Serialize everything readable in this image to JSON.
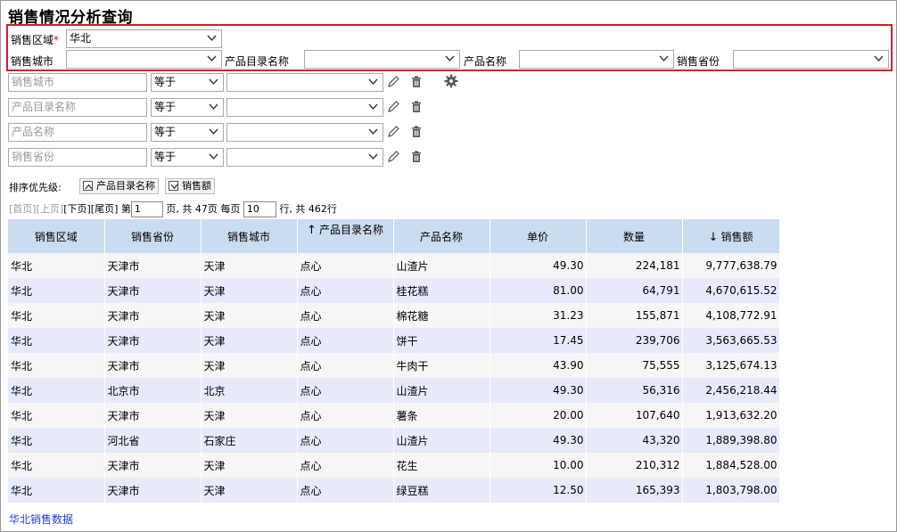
{
  "title": "销售情况分析查询",
  "params": {
    "region_label": "销售区域",
    "region_required": "*",
    "region_value": "华北",
    "city_label": "销售城市",
    "city_value": "",
    "catalog_label": "产品目录名称",
    "catalog_value": "",
    "product_label": "产品名称",
    "product_value": "",
    "province_label": "销售省份",
    "province_value": ""
  },
  "filters": [
    {
      "field_placeholder": "销售城市",
      "op": "等于",
      "value": ""
    },
    {
      "field_placeholder": "产品目录名称",
      "op": "等于",
      "value": ""
    },
    {
      "field_placeholder": "产品名称",
      "op": "等于",
      "value": ""
    },
    {
      "field_placeholder": "销售省份",
      "op": "等于",
      "value": ""
    }
  ],
  "sort": {
    "label": "排序优先级:",
    "items": [
      "产品目录名称",
      "销售额"
    ]
  },
  "pager": {
    "first": "[首页]",
    "prev": "[上页]",
    "next": "[下页]",
    "last": "[尾页]",
    "page_prefix": "第",
    "page_value": "1",
    "page_suffix": "页, 共 47页 每页",
    "per_page_value": "10",
    "total_suffix": "行, 共 462行"
  },
  "table": {
    "headers": [
      "销售区域",
      "销售省份",
      "销售城市",
      "产品目录名称",
      "产品名称",
      "单价",
      "数量",
      "销售额"
    ],
    "sort_up_arrow": "↑",
    "sort_down_arrow": "↓",
    "rows": [
      [
        "华北",
        "天津市",
        "天津",
        "点心",
        "山渣片",
        "49.30",
        "224,181",
        "9,777,638.79"
      ],
      [
        "华北",
        "天津市",
        "天津",
        "点心",
        "桂花糕",
        "81.00",
        "64,791",
        "4,670,615.52"
      ],
      [
        "华北",
        "天津市",
        "天津",
        "点心",
        "棉花糖",
        "31.23",
        "155,871",
        "4,108,772.91"
      ],
      [
        "华北",
        "天津市",
        "天津",
        "点心",
        "饼干",
        "17.45",
        "239,706",
        "3,563,665.53"
      ],
      [
        "华北",
        "天津市",
        "天津",
        "点心",
        "牛肉干",
        "43.90",
        "75,555",
        "3,125,674.13"
      ],
      [
        "华北",
        "北京市",
        "北京",
        "点心",
        "山渣片",
        "49.30",
        "56,316",
        "2,456,218.44"
      ],
      [
        "华北",
        "天津市",
        "天津",
        "点心",
        "薯条",
        "20.00",
        "107,640",
        "1,913,632.20"
      ],
      [
        "华北",
        "河北省",
        "石家庄",
        "点心",
        "山渣片",
        "49.30",
        "43,320",
        "1,889,398.80"
      ],
      [
        "华北",
        "天津市",
        "天津",
        "点心",
        "花生",
        "10.00",
        "210,312",
        "1,884,528.00"
      ],
      [
        "华北",
        "天津市",
        "天津",
        "点心",
        "绿豆糕",
        "12.50",
        "165,393",
        "1,803,798.00"
      ]
    ]
  },
  "footer_link": "华北销售数据",
  "colors": {
    "header_bg": "#cadcf0",
    "row_odd": "#f6f6f6",
    "row_even": "#e6eafb",
    "param_border": "#e0191e",
    "link": "#1e3fd6"
  }
}
